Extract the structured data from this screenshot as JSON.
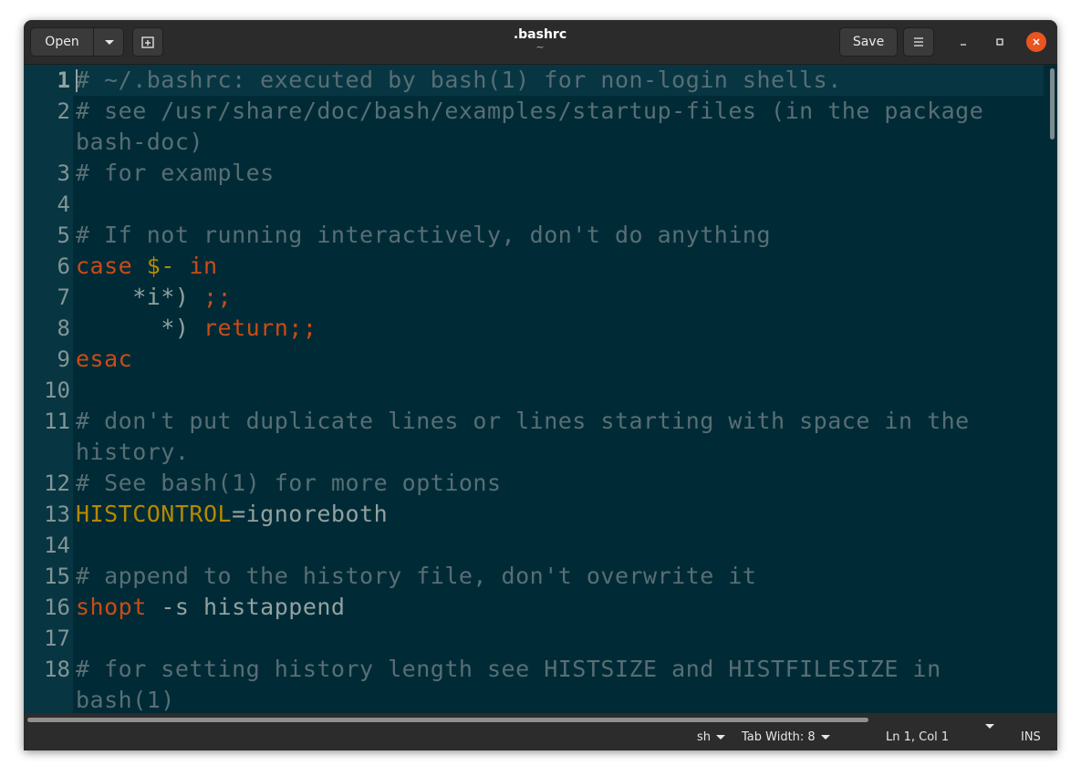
{
  "header": {
    "open_label": "Open",
    "title": ".bashrc",
    "subtitle": "~",
    "save_label": "Save"
  },
  "editor": {
    "current_line": 1,
    "lines": [
      {
        "num": "1",
        "segments": [
          {
            "t": "# ~/.bashrc: executed by bash(1) for non-login shells.",
            "c": "cmt"
          }
        ]
      },
      {
        "num": "2",
        "wrap": true,
        "segments": [
          {
            "t": "# see /usr/share/doc/bash/examples/startup-files (in the package bash-doc)",
            "c": "cmt"
          }
        ]
      },
      {
        "num": "3",
        "segments": [
          {
            "t": "# for examples",
            "c": "cmt"
          }
        ]
      },
      {
        "num": "4",
        "segments": []
      },
      {
        "num": "5",
        "segments": [
          {
            "t": "# If not running interactively, don't do anything",
            "c": "cmt"
          }
        ]
      },
      {
        "num": "6",
        "segments": [
          {
            "t": "case",
            "c": "kw"
          },
          {
            "t": " ",
            "c": ""
          },
          {
            "t": "$-",
            "c": "var"
          },
          {
            "t": " ",
            "c": ""
          },
          {
            "t": "in",
            "c": "kw"
          }
        ]
      },
      {
        "num": "7",
        "segments": [
          {
            "t": "    *i*) ",
            "c": ""
          },
          {
            "t": ";;",
            "c": "kw"
          }
        ]
      },
      {
        "num": "8",
        "segments": [
          {
            "t": "      *) ",
            "c": ""
          },
          {
            "t": "return;;",
            "c": "kw"
          }
        ]
      },
      {
        "num": "9",
        "segments": [
          {
            "t": "esac",
            "c": "kw"
          }
        ]
      },
      {
        "num": "10",
        "segments": []
      },
      {
        "num": "11",
        "wrap": true,
        "segments": [
          {
            "t": "# don't put duplicate lines or lines starting with space in the history.",
            "c": "cmt"
          }
        ]
      },
      {
        "num": "12",
        "segments": [
          {
            "t": "# See bash(1) for more options",
            "c": "cmt"
          }
        ]
      },
      {
        "num": "13",
        "segments": [
          {
            "t": "HISTCONTROL",
            "c": "var"
          },
          {
            "t": "=ignoreboth",
            "c": ""
          }
        ]
      },
      {
        "num": "14",
        "segments": []
      },
      {
        "num": "15",
        "segments": [
          {
            "t": "# append to the history file, don't overwrite it",
            "c": "cmt"
          }
        ]
      },
      {
        "num": "16",
        "segments": [
          {
            "t": "shopt",
            "c": "kw"
          },
          {
            "t": " -s histappend",
            "c": ""
          }
        ]
      },
      {
        "num": "17",
        "segments": []
      },
      {
        "num": "18",
        "wrap": true,
        "segments": [
          {
            "t": "# for setting history length see HISTSIZE and HISTFILESIZE in bash(1)",
            "c": "cmt"
          }
        ]
      }
    ]
  },
  "statusbar": {
    "language": "sh",
    "tab_width": "Tab Width: 8",
    "position": "Ln 1, Col 1",
    "mode": "INS"
  },
  "icons": {
    "open_dropdown": "chevron-down-icon",
    "new_tab": "new-tab-icon",
    "menu": "hamburger-menu-icon",
    "minimize": "minimize-icon",
    "maximize": "maximize-icon",
    "close": "close-icon"
  },
  "colors": {
    "background": "#002b36",
    "current_line": "#073642",
    "comment": "#586e75",
    "keyword": "#cb4b16",
    "variable": "#b58900",
    "text": "#93a1a1",
    "close_button": "#e95420"
  }
}
